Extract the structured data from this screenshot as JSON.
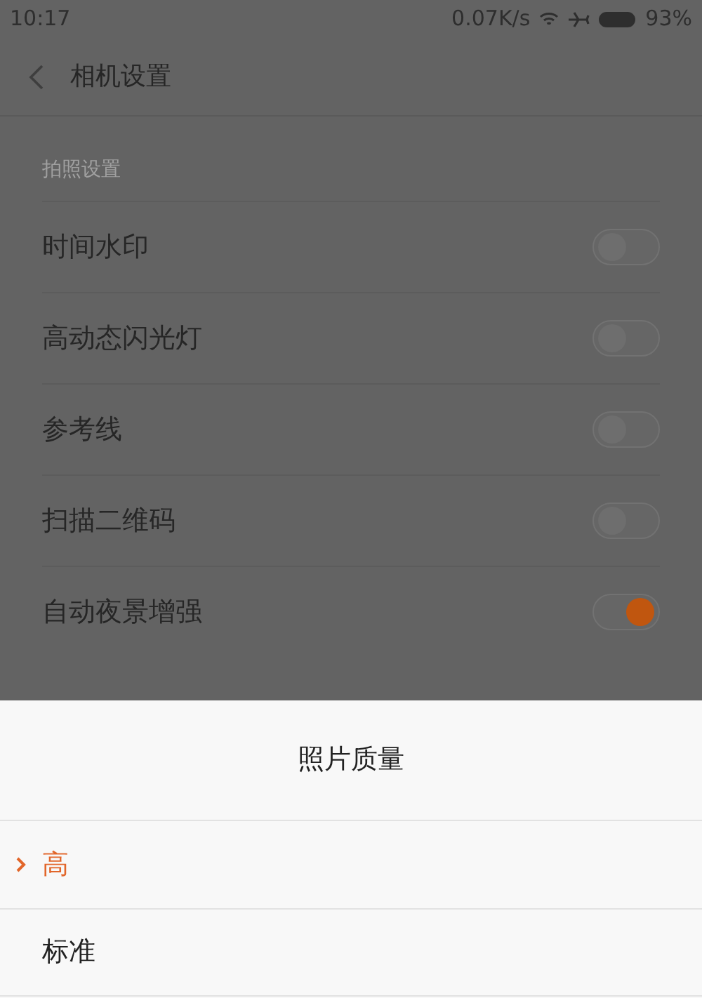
{
  "status_bar": {
    "time": "10:17",
    "speed": "0.07K/s",
    "battery": "93%"
  },
  "header": {
    "title": "相机设置"
  },
  "section": {
    "title": "拍照设置"
  },
  "settings": [
    {
      "label": "时间水印",
      "on": false
    },
    {
      "label": "高动态闪光灯",
      "on": false
    },
    {
      "label": "参考线",
      "on": false
    },
    {
      "label": "扫描二维码",
      "on": false
    },
    {
      "label": "自动夜景增强",
      "on": true
    }
  ],
  "sheet": {
    "title": "照片质量",
    "options": [
      {
        "label": "高",
        "selected": true
      },
      {
        "label": "标准",
        "selected": false
      }
    ]
  }
}
